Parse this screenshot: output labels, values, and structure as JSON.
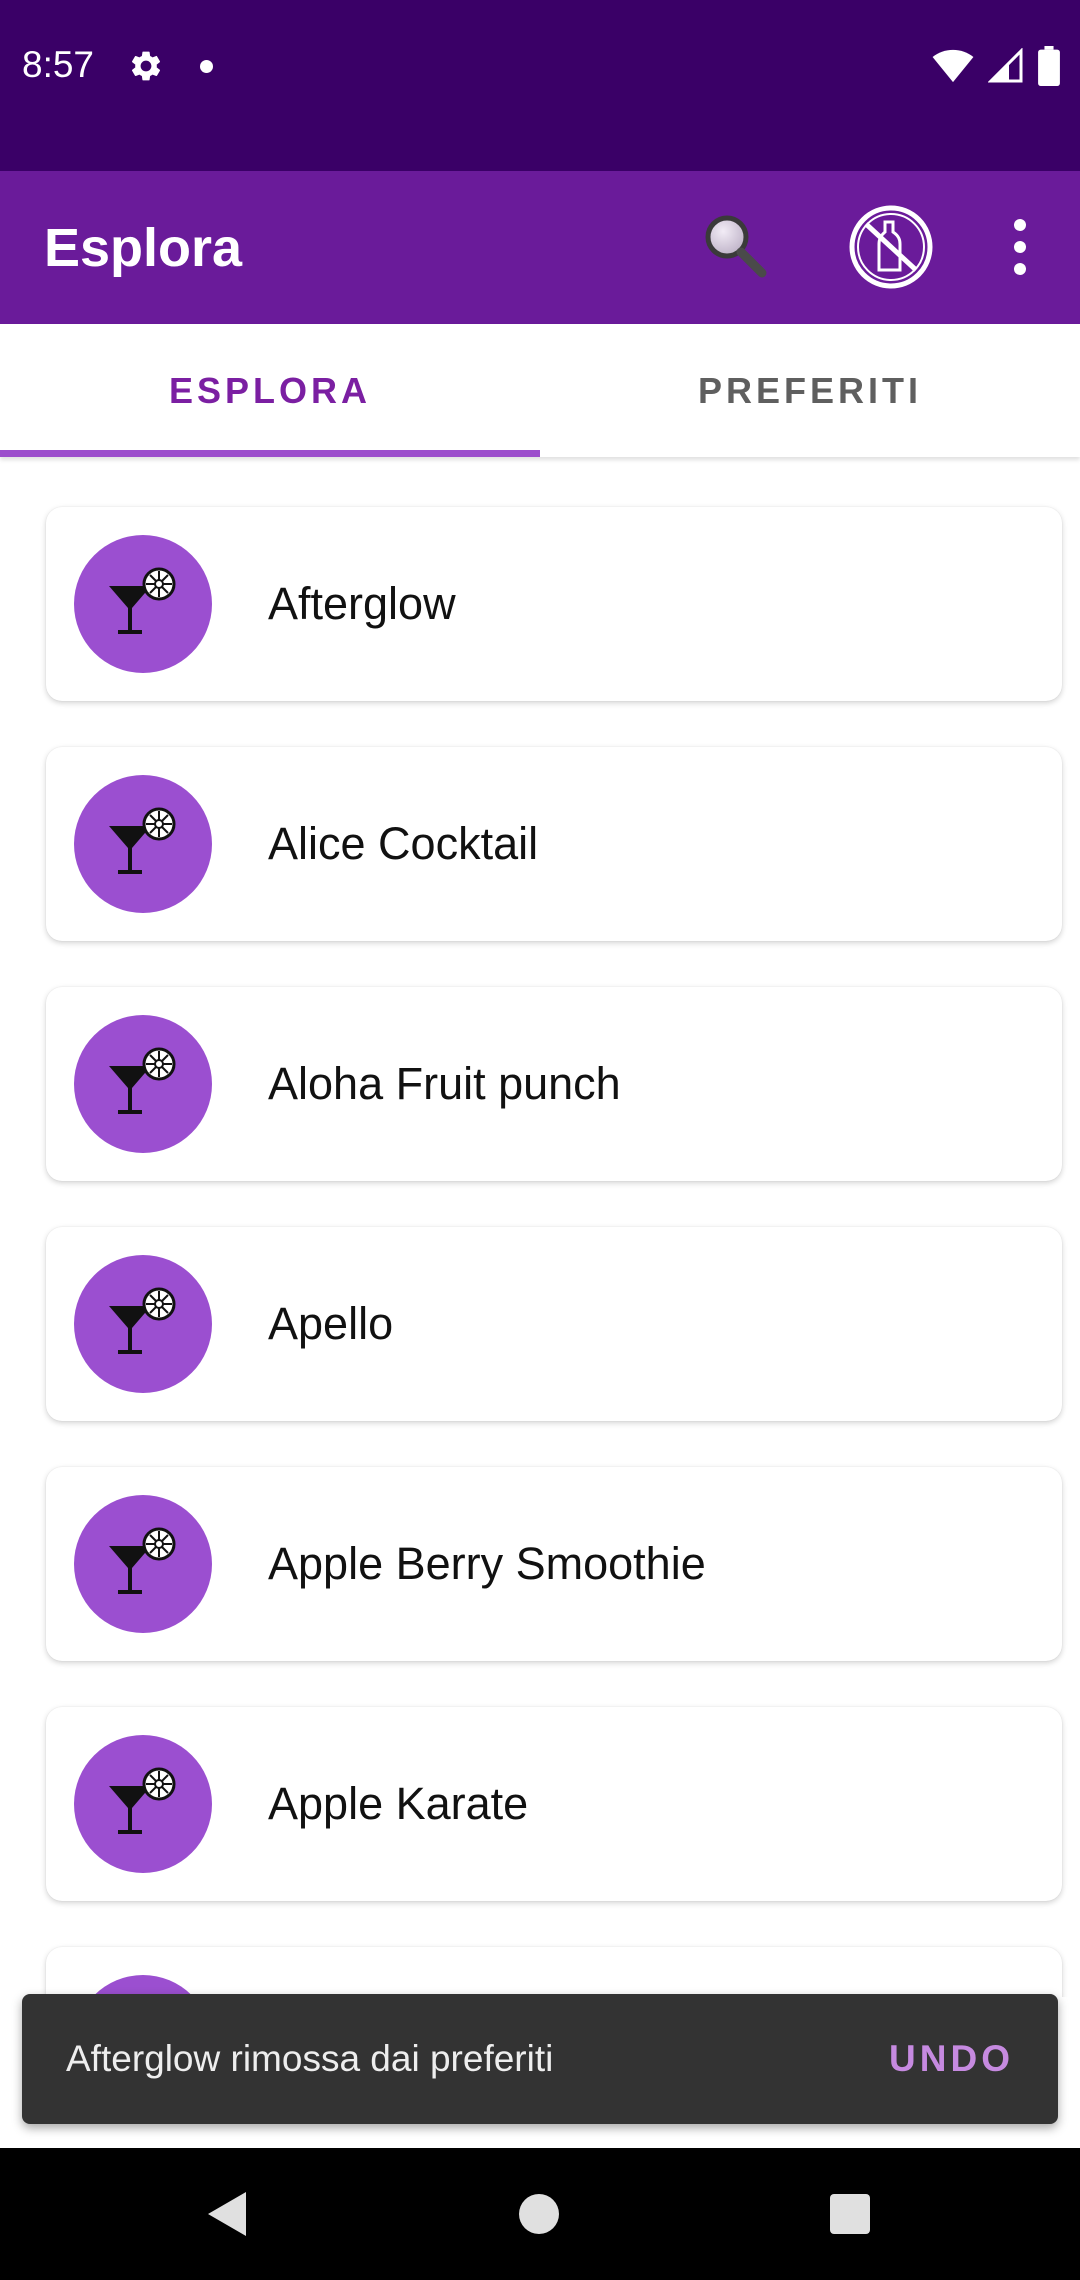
{
  "status_bar": {
    "time": "8:57",
    "icons": [
      "gear-icon",
      "notification-dot-icon",
      "wifi-icon",
      "signal-icon",
      "battery-icon"
    ]
  },
  "app_bar": {
    "title": "Esplora",
    "actions": [
      "search-icon",
      "no-alcohol-icon",
      "more-vert-icon"
    ],
    "color": "#6a1b9a"
  },
  "tabs": [
    {
      "label": "ESPLORA",
      "selected": true
    },
    {
      "label": "PREFERITI",
      "selected": false
    }
  ],
  "cocktails": [
    {
      "name": "Afterglow"
    },
    {
      "name": "Alice Cocktail"
    },
    {
      "name": "Aloha Fruit punch"
    },
    {
      "name": "Apello"
    },
    {
      "name": "Apple Berry Smoothie"
    },
    {
      "name": "Apple Karate"
    },
    {
      "name": ""
    }
  ],
  "snackbar": {
    "message": "Afterglow rimossa dai preferiti",
    "action": "UNDO"
  },
  "colors": {
    "status_bar": "#3a0067",
    "accent": "#7b1fa2",
    "avatar": "#9b4fd0",
    "snackbar_action": "#c68ae0"
  }
}
